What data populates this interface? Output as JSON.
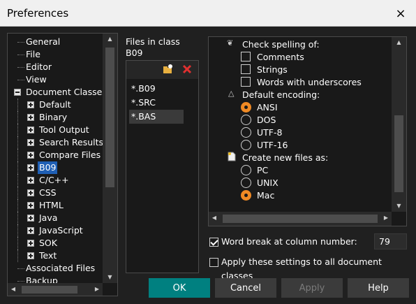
{
  "window": {
    "title": "Preferences",
    "close_icon": "×"
  },
  "tree": {
    "items": [
      {
        "label": "General",
        "level": 0,
        "expander": "none"
      },
      {
        "label": "File",
        "level": 0,
        "expander": "none"
      },
      {
        "label": "Editor",
        "level": 0,
        "expander": "none"
      },
      {
        "label": "View",
        "level": 0,
        "expander": "none"
      },
      {
        "label": "Document Classes",
        "level": 0,
        "expander": "minus"
      },
      {
        "label": "Default",
        "level": 1,
        "expander": "plus"
      },
      {
        "label": "Binary",
        "level": 1,
        "expander": "plus"
      },
      {
        "label": "Tool Output",
        "level": 1,
        "expander": "plus"
      },
      {
        "label": "Search Results",
        "level": 1,
        "expander": "plus"
      },
      {
        "label": "Compare Files",
        "level": 1,
        "expander": "plus"
      },
      {
        "label": "B09",
        "level": 1,
        "expander": "plus",
        "selected": true
      },
      {
        "label": "C/C++",
        "level": 1,
        "expander": "plus"
      },
      {
        "label": "CSS",
        "level": 1,
        "expander": "plus"
      },
      {
        "label": "HTML",
        "level": 1,
        "expander": "plus"
      },
      {
        "label": "Java",
        "level": 1,
        "expander": "plus"
      },
      {
        "label": "JavaScript",
        "level": 1,
        "expander": "plus"
      },
      {
        "label": "SOK",
        "level": 1,
        "expander": "plus"
      },
      {
        "label": "Text",
        "level": 1,
        "expander": "plus"
      },
      {
        "label": "Associated Files",
        "level": 0,
        "expander": "none"
      },
      {
        "label": "Backup",
        "level": 0,
        "expander": "none"
      }
    ]
  },
  "files": {
    "label_line1": "Files in class",
    "label_line2": "B09",
    "entries": [
      "*.B09",
      "*.SRC",
      "*.BAS"
    ],
    "selected_index": 2
  },
  "options": {
    "spelling_header": "Check spelling of:",
    "spelling": [
      {
        "label": "Comments",
        "checked": false
      },
      {
        "label": "Strings",
        "checked": false
      },
      {
        "label": "Words with underscores",
        "checked": false
      }
    ],
    "encoding_header": "Default encoding:",
    "encodings": [
      {
        "label": "ANSI",
        "checked": true
      },
      {
        "label": "DOS",
        "checked": false
      },
      {
        "label": "UTF-8",
        "checked": false
      },
      {
        "label": "UTF-16",
        "checked": false
      }
    ],
    "newfiles_header": "Create new files as:",
    "newfiles": [
      {
        "label": "PC",
        "checked": false
      },
      {
        "label": "UNIX",
        "checked": false
      },
      {
        "label": "Mac",
        "checked": true
      }
    ]
  },
  "wordbreak": {
    "label": "Word break at column number:",
    "checked": true,
    "value": "79"
  },
  "apply_all": {
    "label": "Apply these settings to all document classes",
    "checked": false
  },
  "buttons": {
    "ok": "OK",
    "cancel": "Cancel",
    "apply": "Apply",
    "help": "Help"
  },
  "colors": {
    "accent": "#008080",
    "radio_selected": "#f08a24",
    "selection": "#1f5fb4"
  }
}
